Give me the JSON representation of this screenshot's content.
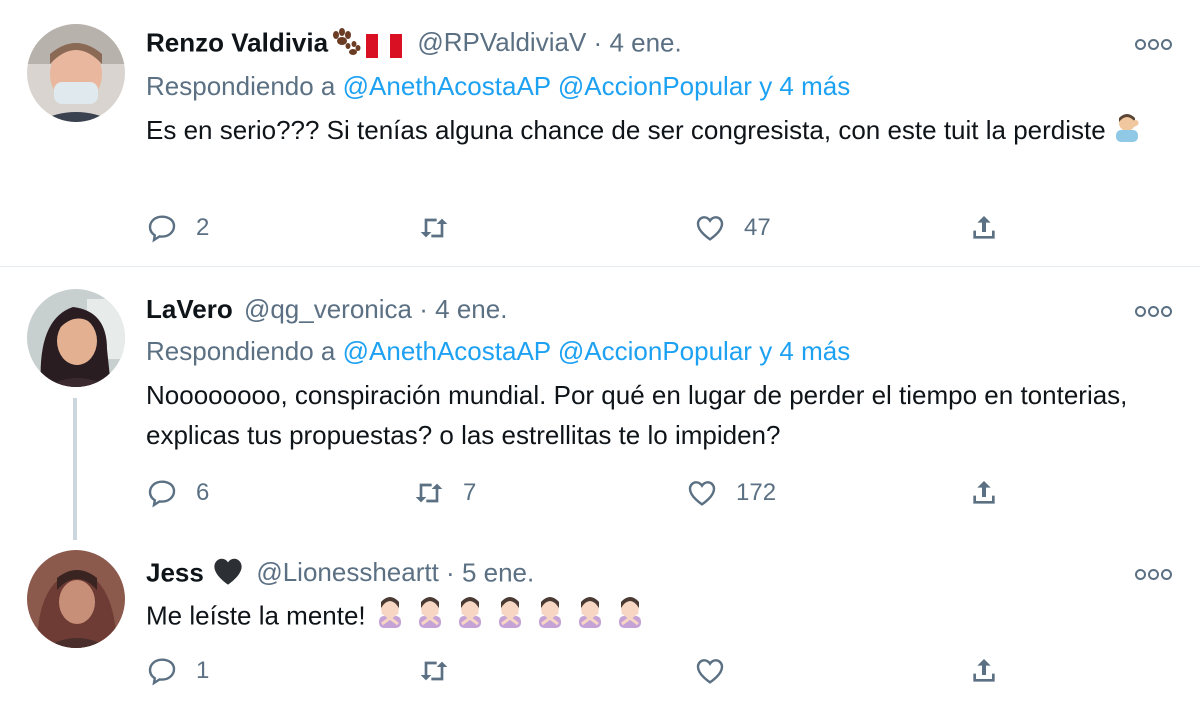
{
  "tweets": [
    {
      "name": "Renzo Valdivia",
      "handle": "@RPValdiviaV",
      "sep": "·",
      "date": "4 ene.",
      "reply_prefix": "Respondiendo a",
      "mention1": "@AnethAcostaAP",
      "mention2": "@AccionPopular",
      "mention_more": "y 4 más",
      "text": "Es en serio??? Si tenías alguna chance de ser congresista, con este tuit la perdiste",
      "reply_count": "2",
      "retweet_count": "",
      "like_count": "47"
    },
    {
      "name": "LaVero",
      "handle": "@qg_veronica",
      "sep": "·",
      "date": "4 ene.",
      "reply_prefix": "Respondiendo a",
      "mention1": "@AnethAcostaAP",
      "mention2": "@AccionPopular",
      "mention_more": "y 4 más",
      "text": "Noooooooo, conspiración mundial. Por qué en lugar de perder el tiempo en tonterias, explicas tus propuestas? o las estrellitas te lo impiden?",
      "reply_count": "6",
      "retweet_count": "7",
      "like_count": "172"
    },
    {
      "name": "Jess",
      "handle": "@Lionessheartt",
      "sep": "·",
      "date": "5 ene.",
      "text": "Me leíste la mente!",
      "reply_count": "1",
      "retweet_count": "",
      "like_count": ""
    }
  ],
  "icons": {
    "reply": "reply-icon",
    "retweet": "retweet-icon",
    "like": "heart-icon",
    "share": "share-icon",
    "more": "more-options-icon"
  },
  "colors": {
    "link": "#1da1f2",
    "muted": "#5b7083",
    "text": "#0f1419",
    "divider": "#e6ecf0"
  }
}
